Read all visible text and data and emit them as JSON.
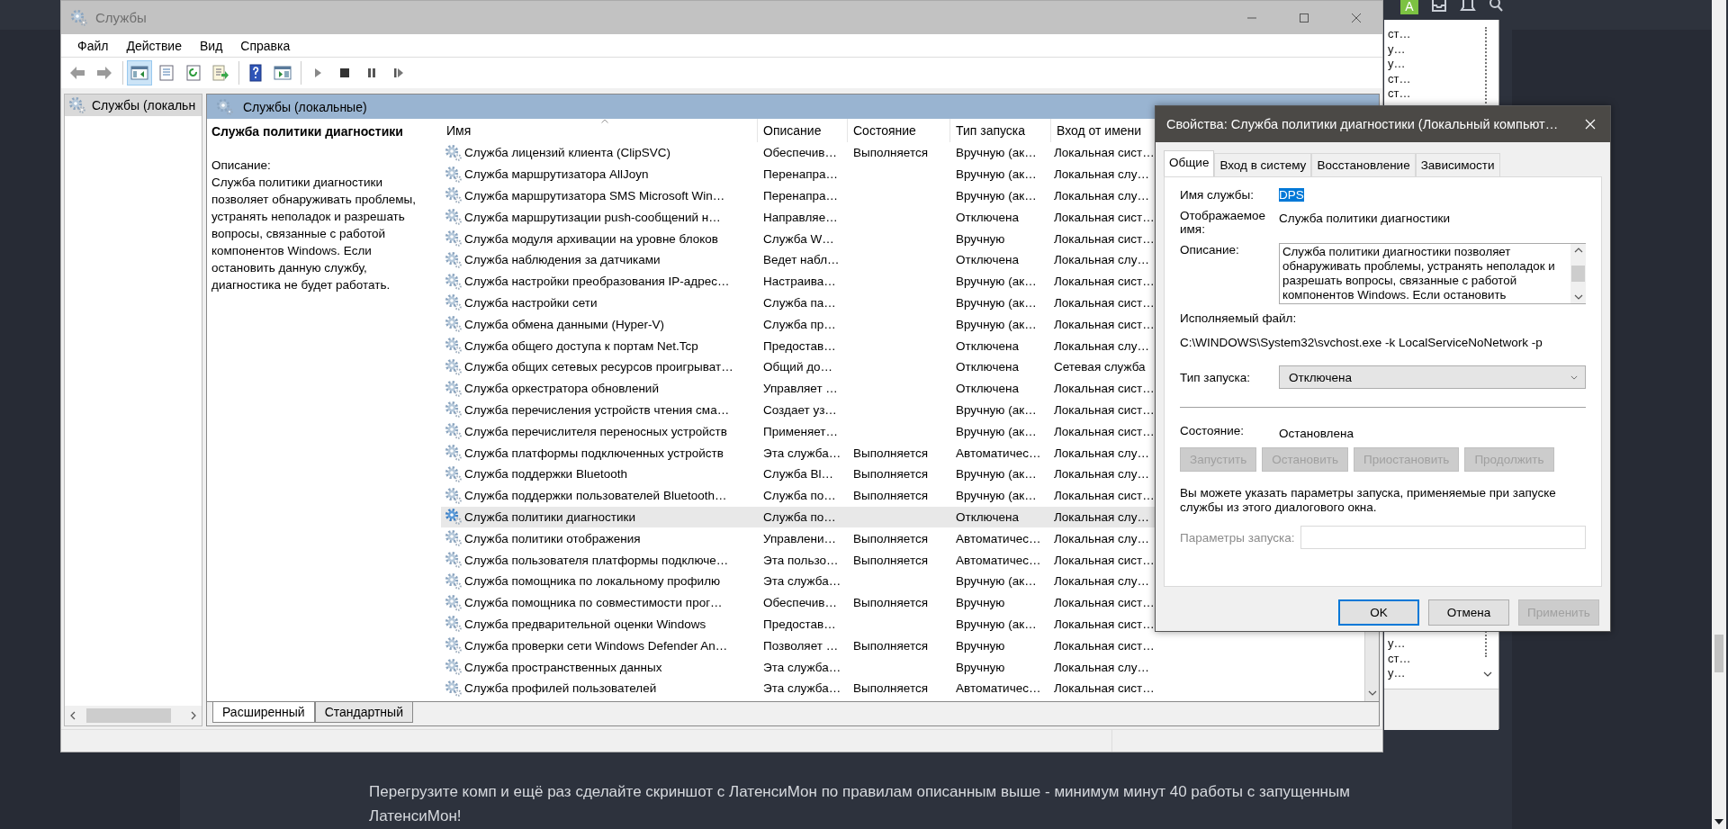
{
  "forum": {
    "avatar_letter": "A",
    "post_text": "Перегрузите комп и ещё раз сделайте скриншот с ЛатенсиМон по правилам описанным выше - минимум минут 40 работы с запущенным ЛатенсиМон!"
  },
  "background_window": {
    "column_fragments_top": [
      "ст…",
      "у…",
      "у…",
      "ст…",
      "ст…"
    ],
    "column_fragments_bottom": [
      "у…",
      "ст…",
      "у…"
    ]
  },
  "window": {
    "title": "Службы"
  },
  "menu": [
    "Файл",
    "Действие",
    "Вид",
    "Справка"
  ],
  "toolbar": [
    {
      "kind": "back",
      "pressed": false
    },
    {
      "kind": "forward",
      "pressed": false
    },
    {
      "kind": "tree",
      "pressed": true
    },
    {
      "kind": "properties",
      "pressed": false
    },
    {
      "kind": "refresh",
      "pressed": false
    },
    {
      "kind": "export",
      "pressed": false
    },
    {
      "kind": "help",
      "pressed": false
    },
    {
      "kind": "console",
      "pressed": false
    },
    {
      "kind": "play",
      "pressed": false
    },
    {
      "kind": "stop",
      "pressed": false
    },
    {
      "kind": "pause",
      "pressed": false
    },
    {
      "kind": "resume",
      "pressed": false
    }
  ],
  "tree": [
    {
      "label": "Службы (локальн",
      "selected": true
    }
  ],
  "panel_header": "Службы (локальные)",
  "details": {
    "title": "Служба политики диагностики",
    "description_label": "Описание:",
    "description": "Служба политики диагностики позволяет обнаруживать проблемы, устранять неполадок и разрешать вопросы, связанные с работой компонентов Windows. Если остановить данную службу, диагностика не будет работать."
  },
  "table": {
    "columns": [
      "Имя",
      "Описание",
      "Состояние",
      "Тип запуска",
      "Вход от имени"
    ],
    "rows": [
      {
        "name": "Служба лицензий клиента (ClipSVC)",
        "description": "Обеспечив…",
        "status": "Выполняется",
        "startup": "Вручную (ак…",
        "logon": "Локальная сист…",
        "selected": false
      },
      {
        "name": "Служба маршрутизатора AllJoyn",
        "description": "Перенапра…",
        "startup": "Вручную (ак…",
        "logon": "Локальная слу…",
        "selected": false
      },
      {
        "name": "Служба маршрутизатора SMS Microsoft Win…",
        "description": "Перенапра…",
        "startup": "Вручную (ак…",
        "logon": "Локальная слу…",
        "selected": false
      },
      {
        "name": "Служба маршрутизации push-сообщений н…",
        "description": "Направляе…",
        "startup": "Отключена",
        "logon": "Локальная сист…",
        "selected": false
      },
      {
        "name": "Служба модуля архивации на уровне блоков",
        "description": "Служба W…",
        "startup": "Вручную",
        "logon": "Локальная сист…",
        "selected": false
      },
      {
        "name": "Служба наблюдения за датчиками",
        "description": "Ведет набл…",
        "startup": "Отключена",
        "logon": "Локальная слу…",
        "selected": false
      },
      {
        "name": "Служба настройки преобразования IP-адрес…",
        "description": "Настраива…",
        "startup": "Вручную (ак…",
        "logon": "Локальная сист…",
        "selected": false
      },
      {
        "name": "Служба настройки сети",
        "description": "Служба па…",
        "startup": "Вручную (ак…",
        "logon": "Локальная сист…",
        "selected": false
      },
      {
        "name": "Служба обмена данными (Hyper-V)",
        "description": "Служба пр…",
        "startup": "Вручную (ак…",
        "logon": "Локальная сист…",
        "selected": false
      },
      {
        "name": "Служба общего доступа к портам Net.Tcp",
        "description": "Предостав…",
        "startup": "Отключена",
        "logon": "Локальная слу…",
        "selected": false
      },
      {
        "name": "Служба общих сетевых ресурсов проигрыват…",
        "description": "Общий до…",
        "startup": "Отключена",
        "logon": "Сетевая служба",
        "selected": false
      },
      {
        "name": "Служба оркестратора обновлений",
        "description": "Управляет …",
        "startup": "Отключена",
        "logon": "Локальная сист…",
        "selected": false
      },
      {
        "name": "Служба перечисления устройств чтения сма…",
        "description": "Создает уз…",
        "startup": "Вручную (ак…",
        "logon": "Локальная сист…",
        "selected": false
      },
      {
        "name": "Служба перечислителя переносных устройств",
        "description": "Применяет…",
        "startup": "Вручную (ак…",
        "logon": "Локальная сист…",
        "selected": false
      },
      {
        "name": "Служба платформы подключенных устройств",
        "description": "Эта служба…",
        "status": "Выполняется",
        "startup": "Автоматичес…",
        "logon": "Локальная слу…",
        "selected": false
      },
      {
        "name": "Служба поддержки Bluetooth",
        "description": "Служба Bl…",
        "status": "Выполняется",
        "startup": "Вручную (ак…",
        "logon": "Локальная слу…",
        "selected": false
      },
      {
        "name": "Служба поддержки пользователей Bluetooth…",
        "description": "Служба по…",
        "status": "Выполняется",
        "startup": "Вручную (ак…",
        "logon": "Локальная сист…",
        "selected": false
      },
      {
        "name": "Служба политики диагностики",
        "description": "Служба по…",
        "startup": "Отключена",
        "logon": "Локальная слу…",
        "selected": true
      },
      {
        "name": "Служба политики отображения",
        "description": "Управлени…",
        "status": "Выполняется",
        "startup": "Автоматичес…",
        "logon": "Локальная слу…",
        "selected": false
      },
      {
        "name": "Служба пользователя платформы подключе…",
        "description": "Эта пользо…",
        "status": "Выполняется",
        "startup": "Автоматичес…",
        "logon": "Локальная сист…",
        "selected": false
      },
      {
        "name": "Служба помощника по локальному профилю",
        "description": "Эта служба…",
        "startup": "Вручную (ак…",
        "logon": "Локальная слу…",
        "selected": false
      },
      {
        "name": "Служба помощника по совместимости прог…",
        "description": "Обеспечив…",
        "status": "Выполняется",
        "startup": "Вручную",
        "logon": "Локальная сист…",
        "selected": false
      },
      {
        "name": "Служба предварительной оценки Windows",
        "description": "Предостав…",
        "startup": "Вручную (ак…",
        "logon": "Локальная сист…",
        "selected": false
      },
      {
        "name": "Служба проверки сети Windows Defender An…",
        "description": "Позволяет …",
        "status": "Выполняется",
        "startup": "Вручную",
        "logon": "Локальная сист…",
        "selected": false
      },
      {
        "name": "Служба пространственных данных",
        "description": "Эта служба…",
        "startup": "Вручную",
        "logon": "Локальная слу…",
        "selected": false
      },
      {
        "name": "Служба профилей пользователей",
        "description": "Эта служба…",
        "status": "Выполняется",
        "startup": "Автоматичес…",
        "logon": "Локальная сист…",
        "selected": false
      }
    ]
  },
  "view_tabs": [
    {
      "label": "Расширенный",
      "selected": true
    },
    {
      "label": "Стандартный",
      "selected": false
    }
  ],
  "dialog": {
    "title": "Свойства: Служба политики диагностики (Локальный компьют…",
    "tabs": [
      {
        "label": "Общие",
        "selected": true
      },
      {
        "label": "Вход в систему",
        "selected": false
      },
      {
        "label": "Восстановление",
        "selected": false
      },
      {
        "label": "Зависимости",
        "selected": false
      }
    ],
    "service_name_label": "Имя службы:",
    "service_name": "DPS",
    "display_name_label": "Отображаемое имя:",
    "display_name": "Служба политики диагностики",
    "description_label": "Описание:",
    "description": "Служба политики диагностики позволяет обнаруживать проблемы, устранять неполадок и разрешать вопросы, связанные с работой компонентов Windows.  Если остановить",
    "executable_label": "Исполняемый файл:",
    "executable": "C:\\WINDOWS\\System32\\svchost.exe -k LocalServiceNoNetwork -p",
    "startup_type_label": "Тип запуска:",
    "startup_type": "Отключена",
    "status_label": "Состояние:",
    "status": "Остановлена",
    "service_buttons": [
      {
        "label": "Запустить",
        "disabled": true
      },
      {
        "label": "Остановить",
        "disabled": true
      },
      {
        "label": "Приостановить",
        "disabled": true
      },
      {
        "label": "Продолжить",
        "disabled": true
      }
    ],
    "note": "Вы можете указать параметры запуска, применяемые при запуске службы из этого диалогового окна.",
    "parameters_label": "Параметры запуска:",
    "parameters_disabled": true,
    "buttons": [
      {
        "label": "OK",
        "default": true,
        "disabled": false
      },
      {
        "label": "Отмена",
        "default": false,
        "disabled": false
      },
      {
        "label": "Применить",
        "default": false,
        "disabled": true
      }
    ]
  }
}
